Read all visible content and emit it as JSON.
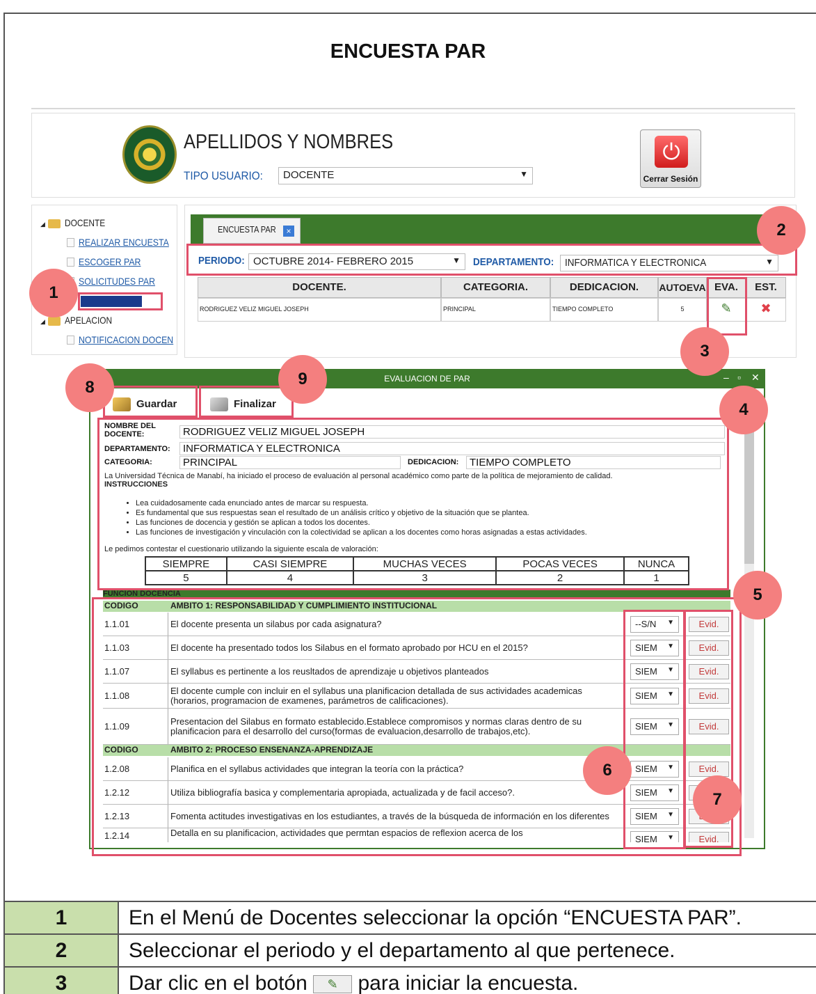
{
  "page": {
    "title": "ENCUESTA PAR"
  },
  "header": {
    "user_name": "APELLIDOS Y NOMBRES",
    "tipo_label": "TIPO USUARIO:",
    "tipo_value": "DOCENTE",
    "logout_label": "Cerrar Sesión"
  },
  "sidebar": {
    "root": "DOCENTE",
    "items": [
      "REALIZAR ENCUESTA",
      "ESCOGER PAR",
      "SOLICITUDES PAR"
    ],
    "root2": "APELACION",
    "items2": [
      "NOTIFICACION DOCEN"
    ]
  },
  "main": {
    "tab_label": "ENCUESTA PAR",
    "periodo_label": "PERIODO:",
    "periodo_value": "OCTUBRE 2014- FEBRERO 2015",
    "departamento_label": "DEPARTAMENTO:",
    "departamento_value": "INFORMATICA Y ELECTRONICA",
    "columns": [
      "DOCENTE.",
      "CATEGORIA.",
      "DEDICACION.",
      "AUTOEVA",
      "EVA.",
      "EST."
    ],
    "row": {
      "docente": "RODRIGUEZ VELIZ MIGUEL JOSEPH",
      "categoria": "PRINCIPAL",
      "dedicacion": "TIEMPO COMPLETO",
      "autoeva": "5"
    }
  },
  "modal": {
    "title": "EVALUACION DE PAR",
    "save_label": "Guardar",
    "finish_label": "Finalizar",
    "nombre_label": "NOMBRE DEL DOCENTE:",
    "nombre_value": "RODRIGUEZ VELIZ MIGUEL JOSEPH",
    "departamento_label": "DEPARTAMENTO:",
    "departamento_value": "INFORMATICA Y ELECTRONICA",
    "categoria_label": "CATEGORIA:",
    "categoria_value": "PRINCIPAL",
    "dedicacion_label": "DEDICACION:",
    "dedicacion_value": "TIEMPO COMPLETO",
    "intro": "La Universidad Técnica de Manabí, ha iniciado el proceso de evaluación al personal académico como parte de la política de mejoramiento de calidad.",
    "instr_title": "INSTRUCCIONES",
    "instructions": [
      "Lea cuidadosamente cada enunciado antes de marcar su respuesta.",
      "Es fundamental que sus respuestas sean el resultado de un análisis crítico y objetivo de la situación que se plantea.",
      "Las funciones de docencia y gestión se aplican a todos los docentes.",
      "Las funciones de investigación y vinculación con la colectividad se aplican a los docentes como horas asignadas a estas actividades."
    ],
    "scale_intro": "Le pedimos contestar el cuestionario utilizando la siguiente escala de valoración:",
    "scale_labels": [
      "SIEMPRE",
      "CASI SIEMPRE",
      "MUCHAS VECES",
      "POCAS VECES",
      "NUNCA"
    ],
    "scale_values": [
      "5",
      "4",
      "3",
      "2",
      "1"
    ],
    "function_header": "FUNCION DOCENCIA",
    "code_header": "CODIGO",
    "ambito1": "AMBITO 1: RESPONSABILIDAD Y CUMPLIMIENTO INSTITUCIONAL",
    "ambito2": "AMBITO 2: PROCESO ENSENANZA-APRENDIZAJE",
    "evid_label": "Evid.",
    "questions1": [
      {
        "code": "1.1.01",
        "text": "El docente presenta un silabus por cada asignatura?",
        "answer": "--S/N"
      },
      {
        "code": "1.1.03",
        "text": "El docente ha presentado todos los Silabus en el formato aprobado por HCU en el 2015?",
        "answer": "SIEM"
      },
      {
        "code": "1.1.07",
        "text": "El syllabus es pertinente a los reusltados de aprendizaje u objetivos planteados",
        "answer": "SIEM"
      },
      {
        "code": "1.1.08",
        "text": "El docente cumple con incluir en el syllabus una planificacion detallada de sus actividades academicas (horarios, programacion de examenes, parámetros de calificaciones).",
        "answer": "SIEM"
      },
      {
        "code": "1.1.09",
        "text": "Presentacion del Silabus en formato establecido.Establece compromisos y normas claras dentro de su planificacion para el desarrollo del curso(formas de evaluacion,desarrollo de trabajos,etc).",
        "answer": "SIEM"
      }
    ],
    "questions2": [
      {
        "code": "1.2.08",
        "text": "Planifica en el syllabus actividades que integran la teoría con la práctica?",
        "answer": "SIEM"
      },
      {
        "code": "1.2.12",
        "text": "Utiliza bibliografía basica y complementaria apropiada, actualizada y de facil acceso?.",
        "answer": "SIEM"
      },
      {
        "code": "1.2.13",
        "text": "Fomenta actitudes investigativas en los estudiantes, a través de la búsqueda de información en los diferentes",
        "answer": "SIEM"
      },
      {
        "code": "1.2.14",
        "text": "Detalla en su planificacion, actividades que permtan espacios de reflexion acerca de los",
        "answer": "SIEM"
      }
    ]
  },
  "badges": [
    "1",
    "2",
    "3",
    "4",
    "5",
    "6",
    "7",
    "8",
    "9"
  ],
  "steps": [
    {
      "num": "1",
      "text": "En el Menú de Docentes seleccionar la opción “ENCUESTA PAR”."
    },
    {
      "num": "2",
      "text": "Seleccionar el periodo y el departamento al que pertenece."
    },
    {
      "num": "3",
      "text_before": "Dar clic en el botón",
      "text_after": "para iniciar la encuesta."
    }
  ]
}
